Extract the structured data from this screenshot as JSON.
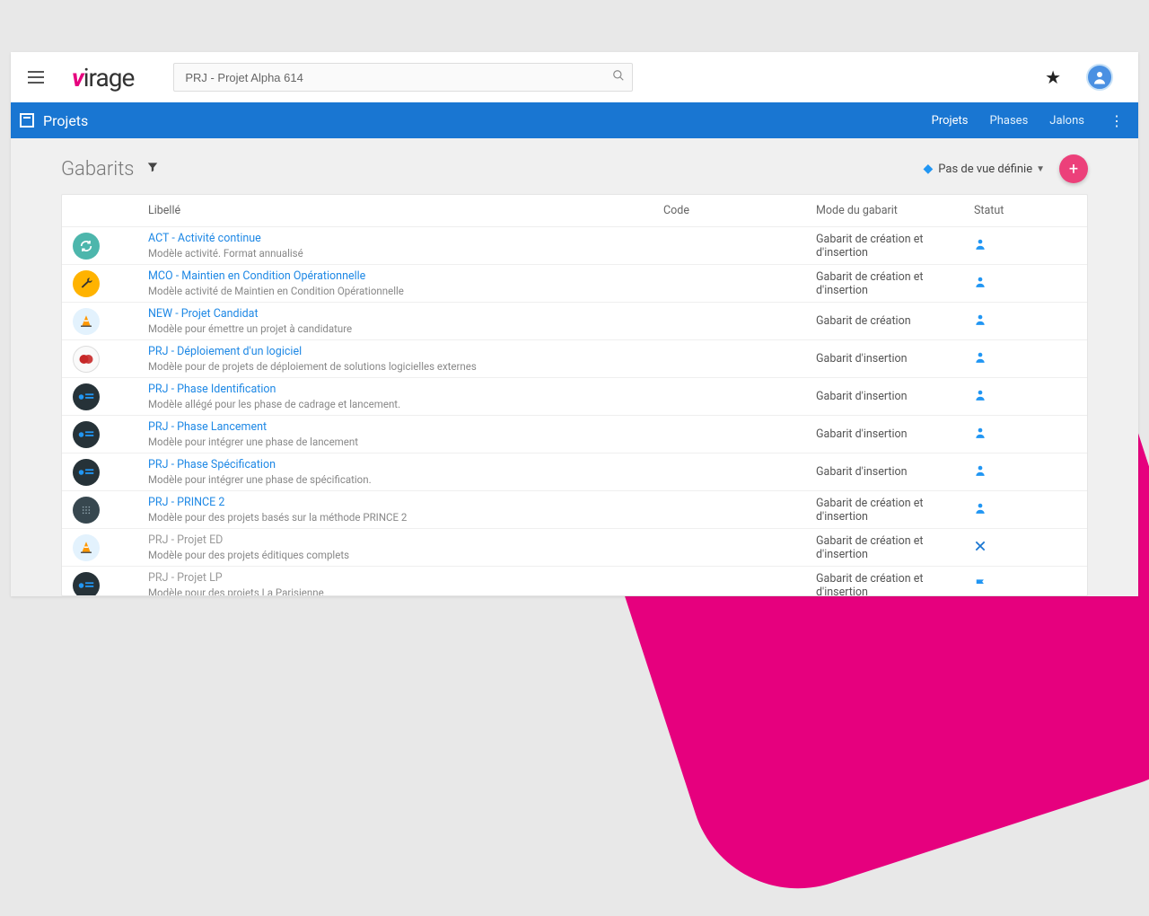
{
  "logo_text": "irage",
  "search": {
    "value": "PRJ - Projet Alpha 614"
  },
  "nav": {
    "title": "Projets",
    "tabs": [
      "Projets",
      "Phases",
      "Jalons"
    ]
  },
  "page": {
    "title": "Gabarits",
    "view_label": "Pas de vue définie"
  },
  "table": {
    "headers": {
      "libelle": "Libellé",
      "code": "Code",
      "mode": "Mode du gabarit",
      "statut": "Statut"
    },
    "rows": [
      {
        "icon": "sync",
        "icon_class": "ic-green",
        "title": "ACT - Activité continue",
        "desc": "Modèle activité. Format annualisé",
        "code": "",
        "mode": "Gabarit de création et d'insertion",
        "statut": "person",
        "muted": false
      },
      {
        "icon": "wrench",
        "icon_class": "ic-yellow",
        "title": "MCO - Maintien en Condition Opérationnelle",
        "desc": "Modèle activité de Maintien en Condition Opérationnelle",
        "code": "",
        "mode": "Gabarit de création et d'insertion",
        "statut": "person",
        "muted": false
      },
      {
        "icon": "cone",
        "icon_class": "ic-cone",
        "title": "NEW - Projet Candidat",
        "desc": "Modèle pour émettre un projet à candidature",
        "code": "",
        "mode": "Gabarit de création",
        "statut": "person",
        "muted": false
      },
      {
        "icon": "cc",
        "icon_class": "ic-red",
        "title": "PRJ - Déploiement d'un logiciel",
        "desc": "Modèle pour de projets de déploiement de solutions logicielles externes",
        "code": "",
        "mode": "Gabarit d'insertion",
        "statut": "person",
        "muted": false
      },
      {
        "icon": "card",
        "icon_class": "ic-blue",
        "title": "PRJ - Phase Identification",
        "desc": "Modèle allégé pour les phase de cadrage et lancement.",
        "code": "",
        "mode": "Gabarit d'insertion",
        "statut": "person",
        "muted": false
      },
      {
        "icon": "card",
        "icon_class": "ic-blue",
        "title": "PRJ - Phase Lancement",
        "desc": "Modèle pour intégrer une phase de lancement",
        "code": "",
        "mode": "Gabarit d'insertion",
        "statut": "person",
        "muted": false
      },
      {
        "icon": "card",
        "icon_class": "ic-blue",
        "title": "PRJ - Phase Spécification",
        "desc": "Modèle pour intégrer une phase de spécification.",
        "code": "",
        "mode": "Gabarit d'insertion",
        "statut": "person",
        "muted": false
      },
      {
        "icon": "dots",
        "icon_class": "ic-dots",
        "title": "PRJ - PRINCE 2",
        "desc": "Modèle pour des projets basés sur la méthode PRINCE 2",
        "code": "",
        "mode": "Gabarit de création et d'insertion",
        "statut": "person",
        "muted": false
      },
      {
        "icon": "cone",
        "icon_class": "ic-cone",
        "title": "PRJ - Projet ED",
        "desc": "Modèle pour des projets éditiques complets",
        "code": "",
        "mode": "Gabarit de création et d'insertion",
        "statut": "close",
        "muted": true
      },
      {
        "icon": "card",
        "icon_class": "ic-blue",
        "title": "PRJ - Projet LP",
        "desc": "Modèle pour des projets La Parisienne",
        "code": "",
        "mode": "Gabarit de création et d'insertion",
        "statut": "flag",
        "muted": true
      }
    ]
  }
}
